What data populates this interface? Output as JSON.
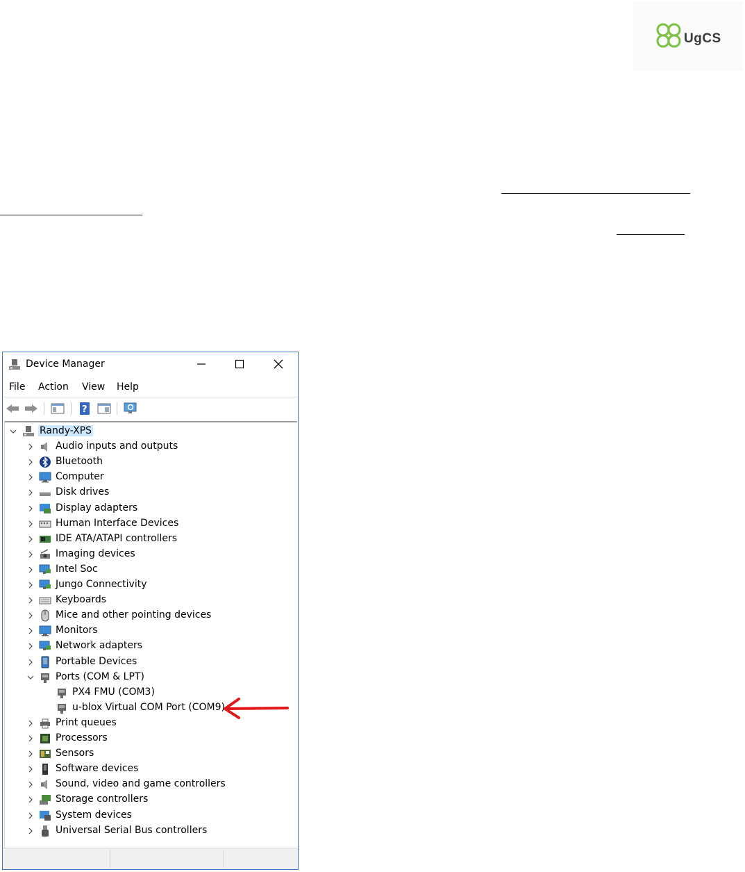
{
  "logo": {
    "text": "UgCS"
  },
  "window": {
    "title": "Device Manager",
    "menu": [
      "File",
      "Action",
      "View",
      "Help"
    ],
    "root": "Randy-XPS",
    "categories": [
      {
        "label": "Audio inputs and outputs",
        "icon": "speaker-icon"
      },
      {
        "label": "Bluetooth",
        "icon": "bluetooth-icon"
      },
      {
        "label": "Computer",
        "icon": "monitor-icon"
      },
      {
        "label": "Disk drives",
        "icon": "disk-icon"
      },
      {
        "label": "Display adapters",
        "icon": "display-adapter-icon"
      },
      {
        "label": "Human Interface Devices",
        "icon": "hid-icon"
      },
      {
        "label": "IDE ATA/ATAPI controllers",
        "icon": "ide-icon"
      },
      {
        "label": "Imaging devices",
        "icon": "camera-icon"
      },
      {
        "label": "Intel Soc",
        "icon": "network-icon"
      },
      {
        "label": "Jungo Connectivity",
        "icon": "network-icon"
      },
      {
        "label": "Keyboards",
        "icon": "keyboard-icon"
      },
      {
        "label": "Mice and other pointing devices",
        "icon": "mouse-icon"
      },
      {
        "label": "Monitors",
        "icon": "monitor-icon"
      },
      {
        "label": "Network adapters",
        "icon": "network-icon"
      },
      {
        "label": "Portable Devices",
        "icon": "portable-icon"
      },
      {
        "label": "Ports (COM & LPT)",
        "icon": "port-icon",
        "expanded": true,
        "children": [
          "PX4 FMU (COM3)",
          "u-blox Virtual COM Port (COM9)"
        ]
      },
      {
        "label": "Print queues",
        "icon": "printer-icon"
      },
      {
        "label": "Processors",
        "icon": "chip-icon"
      },
      {
        "label": "Sensors",
        "icon": "sensor-icon"
      },
      {
        "label": "Software devices",
        "icon": "software-icon"
      },
      {
        "label": "Sound, video and game controllers",
        "icon": "speaker-icon"
      },
      {
        "label": "Storage controllers",
        "icon": "storage-icon"
      },
      {
        "label": "System devices",
        "icon": "system-icon"
      },
      {
        "label": "Universal Serial Bus controllers",
        "icon": "usb-icon"
      }
    ]
  },
  "colors": {
    "accent": "#3b78c0",
    "arrow": "#e0181b",
    "logo_green": "#7bc242"
  }
}
